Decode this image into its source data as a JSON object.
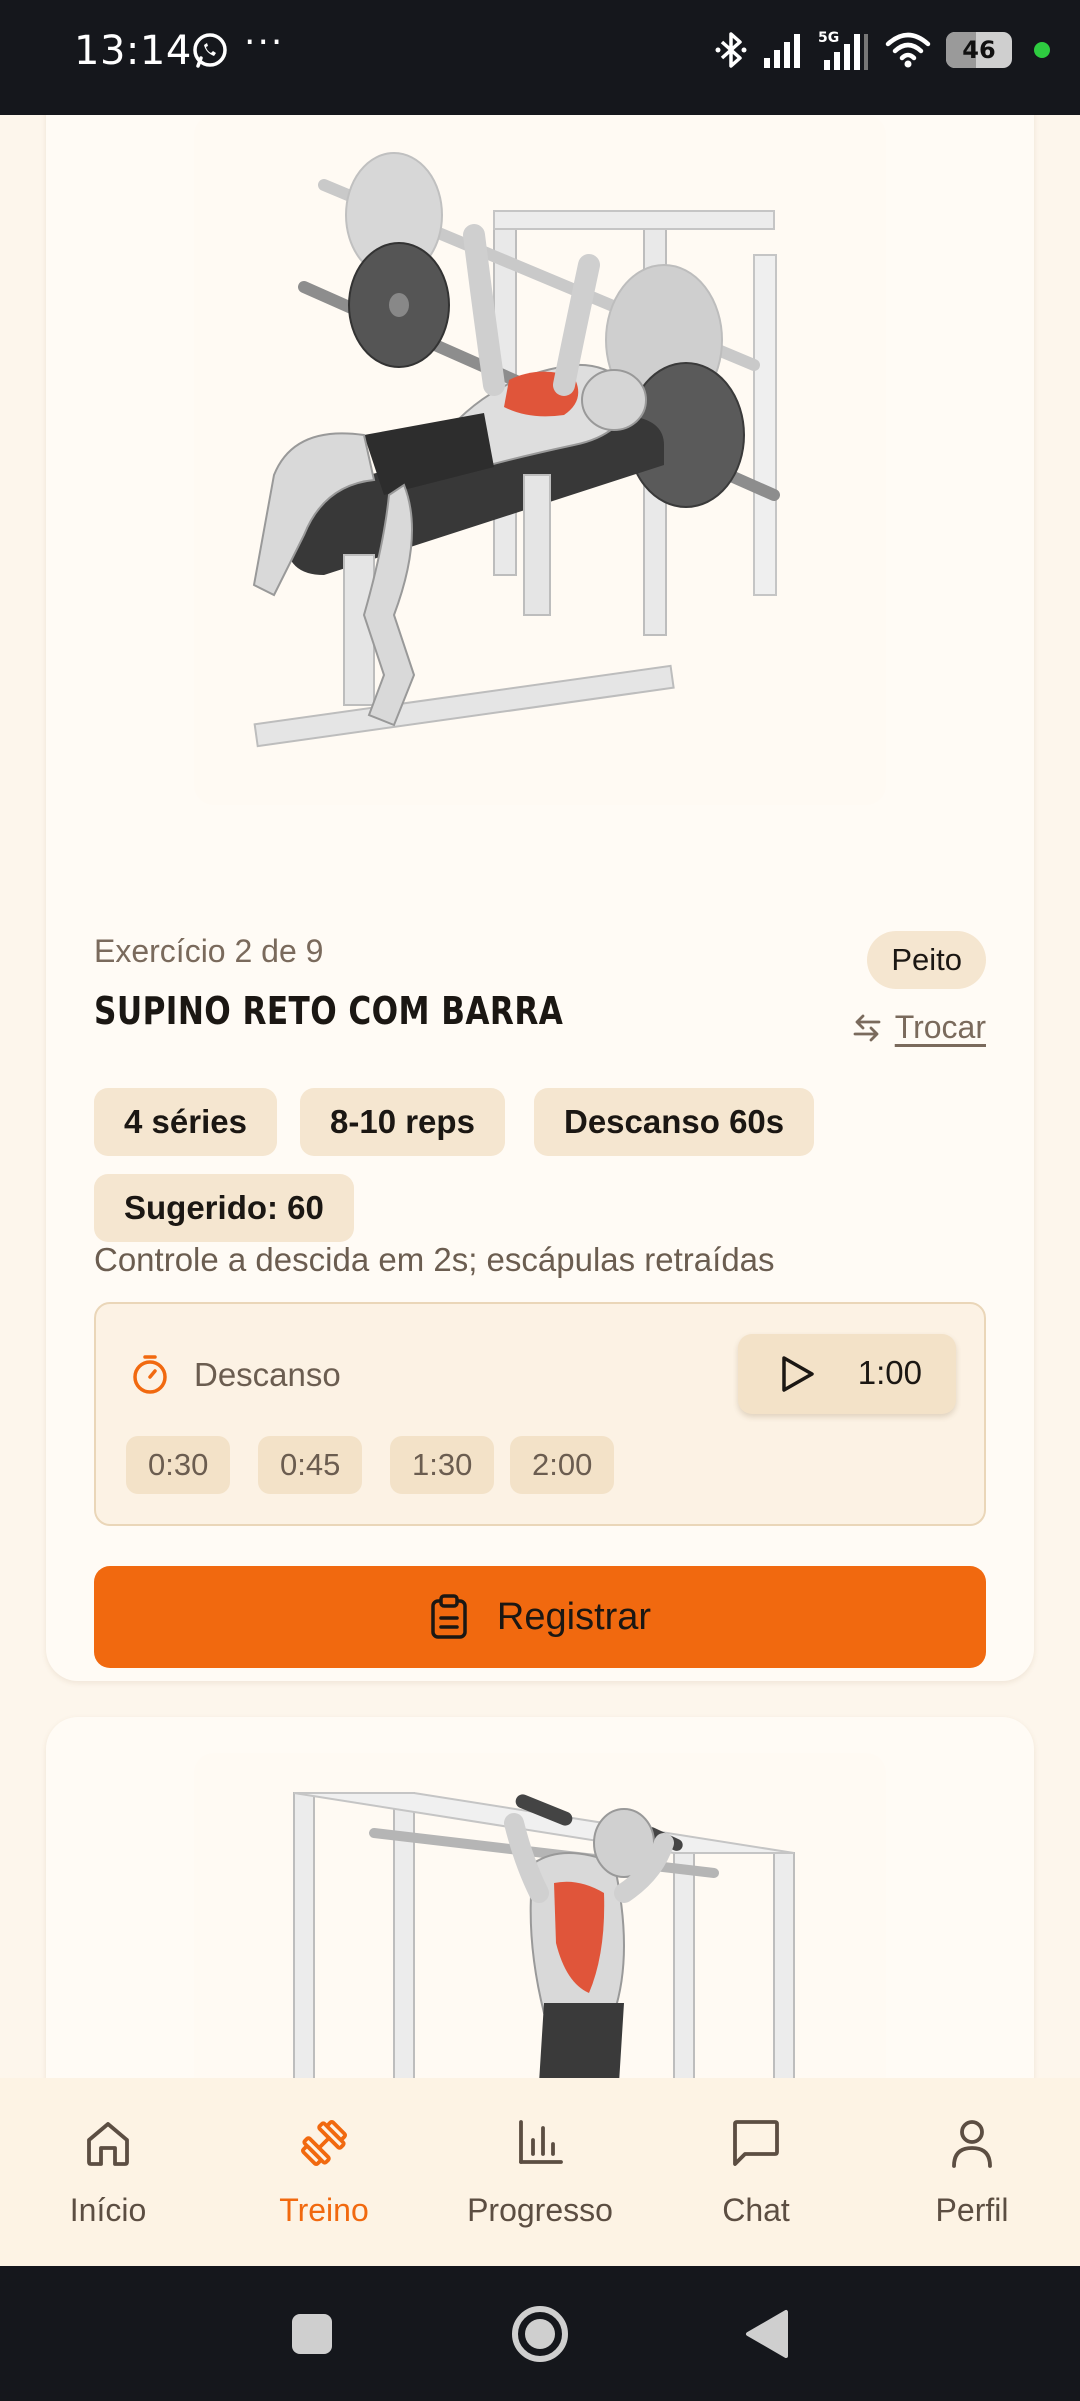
{
  "status_bar": {
    "time": "13:14",
    "battery": "46",
    "icons": [
      "whatsapp-icon",
      "more-icon",
      "bluetooth-icon",
      "signal-icon",
      "5g-signal-icon",
      "wifi-icon",
      "battery-icon"
    ]
  },
  "exercise": {
    "counter": "Exercício 2 de 9",
    "name": "SUPINO RETO COM BARRA",
    "muscle": "Peito",
    "swap_label": "Trocar",
    "chips": [
      "4 séries",
      "8-10 reps",
      "Descanso 60s",
      "Sugerido: 60"
    ],
    "note": "Controle a descida em 2s; escápulas retraídas",
    "rest": {
      "label": "Descanso",
      "timer": "1:00",
      "presets": [
        "0:30",
        "0:45",
        "1:30",
        "2:00"
      ]
    },
    "register_label": "Registrar"
  },
  "nav": {
    "items": [
      {
        "label": "Início",
        "icon": "home-icon"
      },
      {
        "label": "Treino",
        "icon": "dumbbell-icon",
        "active": true
      },
      {
        "label": "Progresso",
        "icon": "bar-chart-icon"
      },
      {
        "label": "Chat",
        "icon": "chat-icon"
      },
      {
        "label": "Perfil",
        "icon": "user-icon"
      }
    ]
  },
  "colors": {
    "accent": "#f1690f",
    "background": "#fdf6ec",
    "card": "#fffbf5",
    "chip": "#f5e6d0",
    "muscle_highlight": "#e0553a"
  }
}
